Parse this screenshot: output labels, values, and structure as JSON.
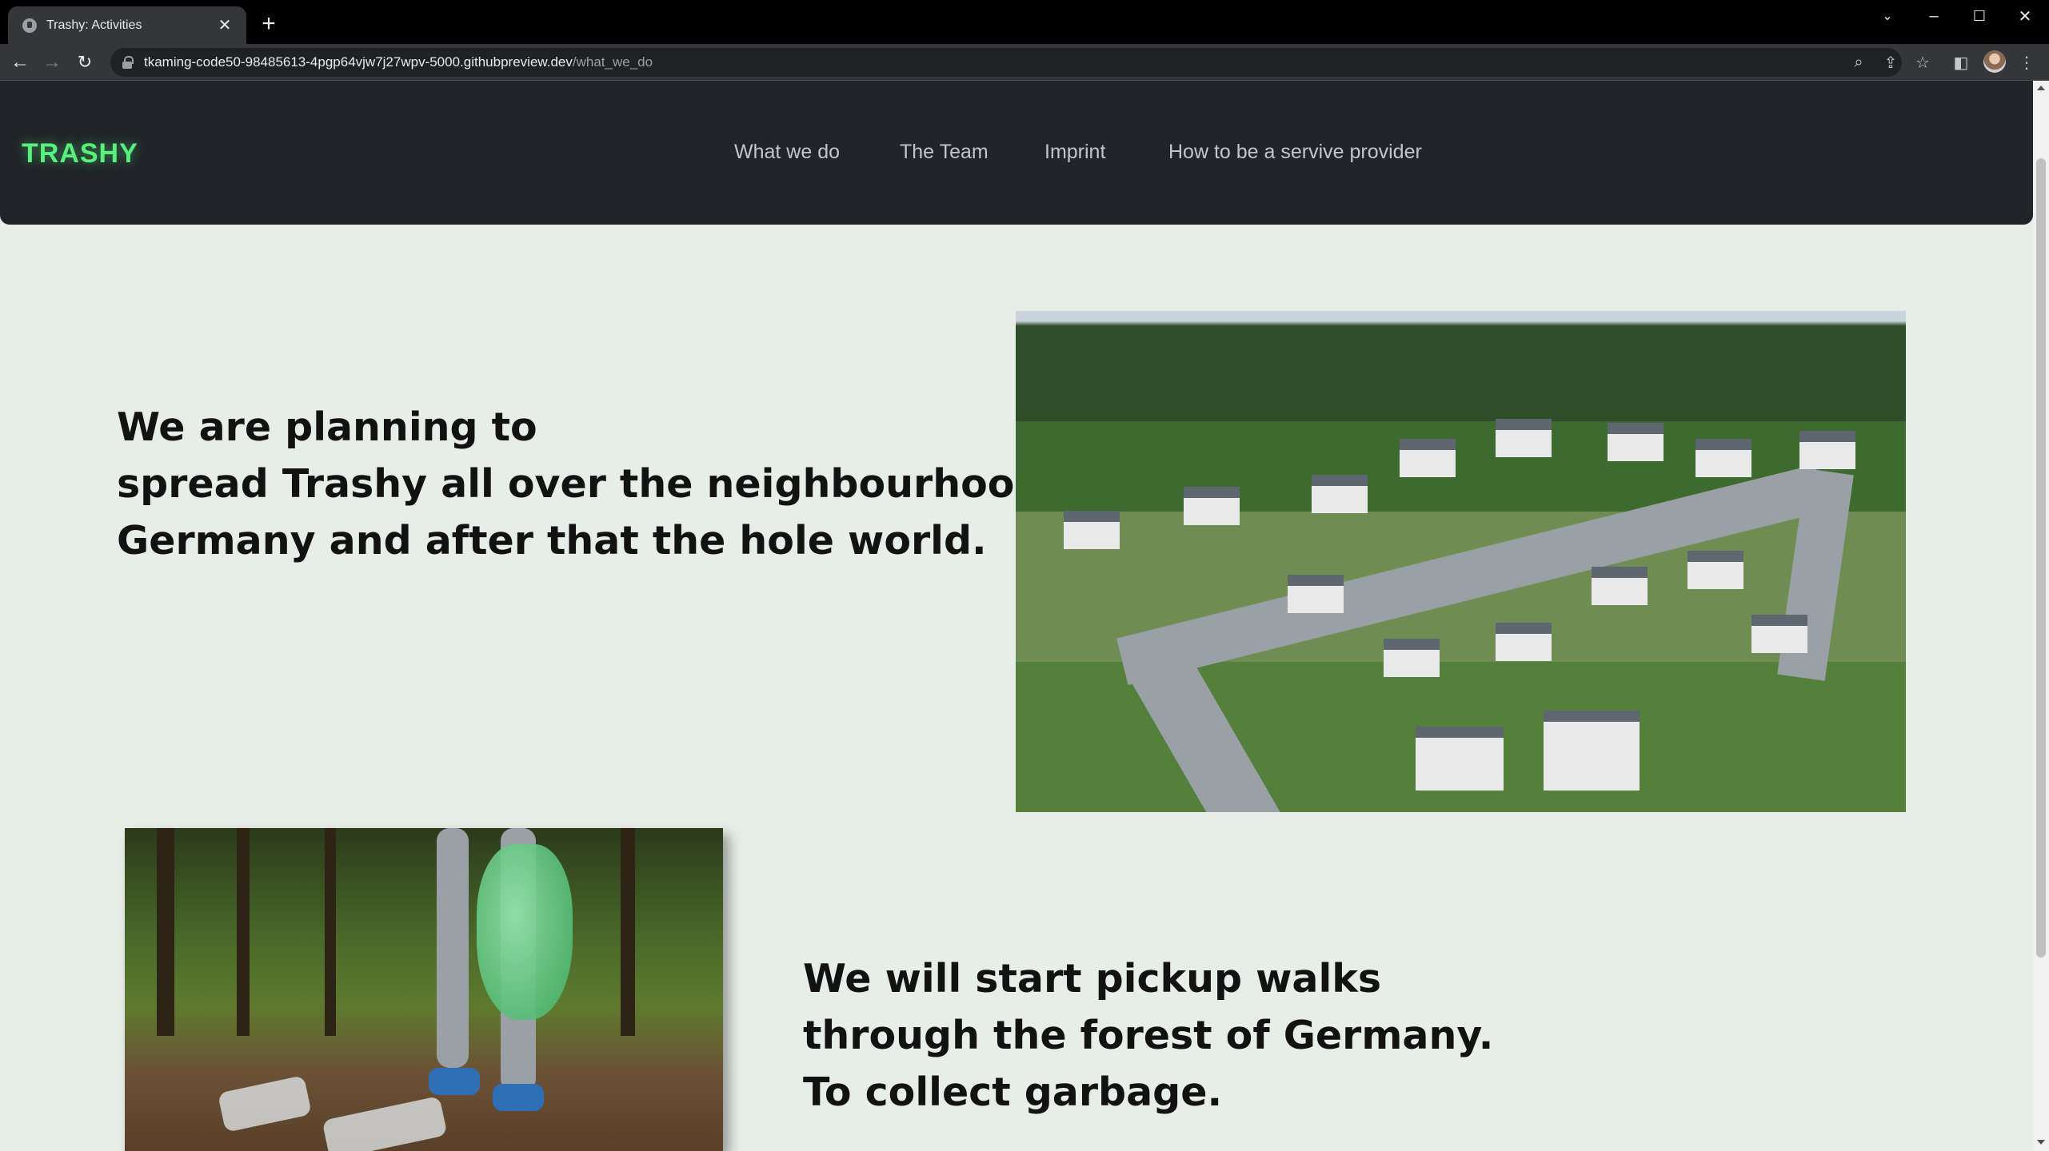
{
  "browser": {
    "tab_title": "Trashy: Activities",
    "url_host": "tkaming-code50-98485613-4pgp64vjw7j27wpv-5000.githubpreview.dev",
    "url_path": "/what_we_do"
  },
  "site": {
    "brand": "TRASHY",
    "nav": [
      "What we do",
      "The Team",
      "Imprint",
      "How to be a servive provider"
    ],
    "colors": {
      "nav_bg": "#212529",
      "brand": "#57f07d",
      "page_bg": "#e7ede7"
    }
  },
  "sections": [
    {
      "lines": [
        "We are planning to",
        "spread Trashy all over the neighbourhoods of",
        "Germany and after that the hole world."
      ],
      "image": "aerial-neighbourhood-photo"
    },
    {
      "lines": [
        "We will start pickup walks",
        "through the forest of Germany.",
        "To collect garbage."
      ],
      "image": "forest-trash-pickup-photo"
    }
  ]
}
